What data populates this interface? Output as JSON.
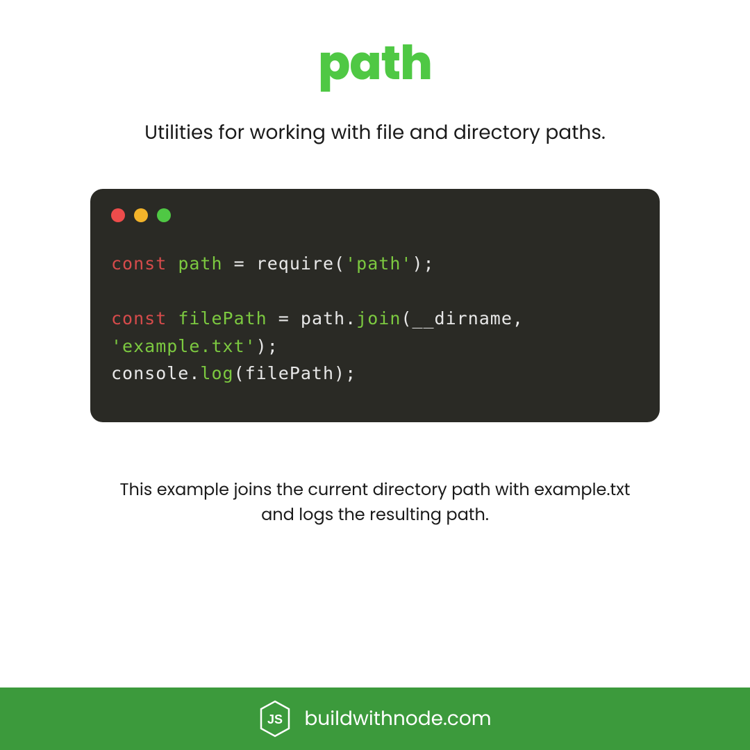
{
  "title": "path",
  "subtitle": "Utilities for working with file and directory paths.",
  "code": {
    "line1_kw": "const",
    "line1_var": "path",
    "line1_rest1": " = require(",
    "line1_str": "'path'",
    "line1_rest2": ");",
    "line2_kw": "const",
    "line2_var": "filePath",
    "line2_rest1": " = path.",
    "line2_fn": "join",
    "line2_rest2": "(__dirname, ",
    "line3_str": "'example.txt'",
    "line3_rest": ");",
    "line4_rest1": "console.",
    "line4_fn": "log",
    "line4_rest2": "(filePath);"
  },
  "description": "This example joins the current directory path with example.txt and logs the resulting path.",
  "footer": {
    "text": "buildwithnode.com",
    "logo_label": "JS"
  },
  "colors": {
    "accent_green": "#4fc844",
    "footer_green": "#3c9a3c",
    "code_bg": "#2a2a25",
    "dot_red": "#ed4c4b",
    "dot_yellow": "#f2b32a",
    "dot_green": "#4fc844"
  }
}
